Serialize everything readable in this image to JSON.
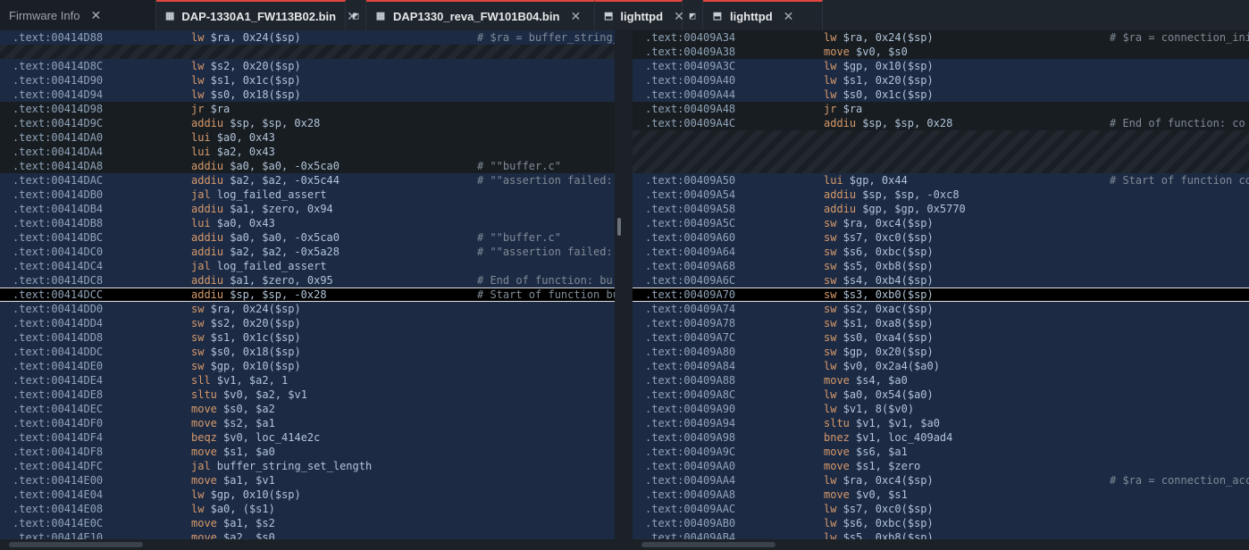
{
  "tabs": [
    {
      "label": "Firmware Info",
      "icon": "info-icon",
      "active": false,
      "width": 175
    },
    {
      "label": "DAP-1330A1_FW113B02.bin",
      "icon": "binary-file-icon",
      "active": true,
      "width": 212,
      "split": true
    },
    {
      "label": "DAP1330_reva_FW101B04.bin",
      "icon": "binary-file-icon",
      "active": true,
      "width": 256
    },
    {
      "label": "lighttpd",
      "icon": "executable-file-icon",
      "active": true,
      "width": 98,
      "split": true
    },
    {
      "label": "lighttpd",
      "icon": "executable-file-icon",
      "active": true,
      "width": 134
    }
  ],
  "left_pane": {
    "lines": [
      {
        "a": ".text:00414D88",
        "m": "lw",
        "o": "$ra, 0x24($sp)",
        "c": "# $ra = buffer_string_",
        "s": "sel"
      },
      {
        "gap": 1
      },
      {
        "a": ".text:00414D8C",
        "m": "lw",
        "o": "$s2, 0x20($sp)",
        "s": "sel"
      },
      {
        "a": ".text:00414D90",
        "m": "lw",
        "o": "$s1, 0x1c($sp)",
        "s": "sel"
      },
      {
        "a": ".text:00414D94",
        "m": "lw",
        "o": "$s0, 0x18($sp)",
        "s": "sel"
      },
      {
        "a": ".text:00414D98",
        "m": "jr",
        "o": "$ra",
        "s": "dark"
      },
      {
        "a": ".text:00414D9C",
        "m": "addiu",
        "o": "$sp, $sp, 0x28",
        "s": "dark"
      },
      {
        "a": ".text:00414DA0",
        "m": "lui",
        "o": "$a0, 0x43",
        "s": "dark"
      },
      {
        "a": ".text:00414DA4",
        "m": "lui",
        "o": "$a2, 0x43",
        "s": "dark"
      },
      {
        "a": ".text:00414DA8",
        "m": "addiu",
        "o": "$a0, $a0, -0x5ca0",
        "c": "# \"\"buffer.c\"",
        "s": "dark"
      },
      {
        "a": ".text:00414DAC",
        "m": "addiu",
        "o": "$a2, $a2, -0x5c44",
        "c": "# \"\"assertion failed:",
        "s": "sel"
      },
      {
        "a": ".text:00414DB0",
        "m": "jal",
        "o": "log_failed_assert",
        "s": "sel"
      },
      {
        "a": ".text:00414DB4",
        "m": "addiu",
        "o": "$a1, $zero, 0x94",
        "s": "sel"
      },
      {
        "a": ".text:00414DB8",
        "m": "lui",
        "o": "$a0, 0x43",
        "s": "sel"
      },
      {
        "a": ".text:00414DBC",
        "m": "addiu",
        "o": "$a0, $a0, -0x5ca0",
        "c": "# \"\"buffer.c\"",
        "s": "sel"
      },
      {
        "a": ".text:00414DC0",
        "m": "addiu",
        "o": "$a2, $a2, -0x5a28",
        "c": "# \"\"assertion failed:",
        "s": "sel"
      },
      {
        "a": ".text:00414DC4",
        "m": "jal",
        "o": "log_failed_assert",
        "s": "sel"
      },
      {
        "a": ".text:00414DC8",
        "m": "addiu",
        "o": "$a1, $zero, 0x95",
        "c": "# End of function: bu",
        "s": "sel"
      },
      {
        "a": ".text:00414DCC",
        "m": "addiu",
        "o": "$sp, $sp, -0x28",
        "c": "# Start of function bu",
        "s": "cur"
      },
      {
        "a": ".text:00414DD0",
        "m": "sw",
        "o": "$ra, 0x24($sp)",
        "s": "sel"
      },
      {
        "a": ".text:00414DD4",
        "m": "sw",
        "o": "$s2, 0x20($sp)",
        "s": "sel"
      },
      {
        "a": ".text:00414DD8",
        "m": "sw",
        "o": "$s1, 0x1c($sp)",
        "s": "sel"
      },
      {
        "a": ".text:00414DDC",
        "m": "sw",
        "o": "$s0, 0x18($sp)",
        "s": "sel"
      },
      {
        "a": ".text:00414DE0",
        "m": "sw",
        "o": "$gp, 0x10($sp)",
        "s": "sel"
      },
      {
        "a": ".text:00414DE4",
        "m": "sll",
        "o": "$v1, $a2, 1",
        "s": "sel"
      },
      {
        "a": ".text:00414DE8",
        "m": "sltu",
        "o": "$v0, $a2, $v1",
        "s": "sel"
      },
      {
        "a": ".text:00414DEC",
        "m": "move",
        "o": "$s0, $a2",
        "s": "sel"
      },
      {
        "a": ".text:00414DF0",
        "m": "move",
        "o": "$s2, $a1",
        "s": "sel"
      },
      {
        "a": ".text:00414DF4",
        "m": "beqz",
        "o": "$v0, loc_414e2c",
        "s": "sel"
      },
      {
        "a": ".text:00414DF8",
        "m": "move",
        "o": "$s1, $a0",
        "s": "sel"
      },
      {
        "a": ".text:00414DFC",
        "m": "jal",
        "o": "buffer_string_set_length",
        "s": "sel"
      },
      {
        "a": ".text:00414E00",
        "m": "move",
        "o": "$a1, $v1",
        "s": "sel"
      },
      {
        "a": ".text:00414E04",
        "m": "lw",
        "o": "$gp, 0x10($sp)",
        "s": "sel"
      },
      {
        "a": ".text:00414E08",
        "m": "lw",
        "o": "$a0, ($s1)",
        "s": "sel"
      },
      {
        "a": ".text:00414E0C",
        "m": "move",
        "o": "$a1, $s2",
        "s": "sel"
      },
      {
        "a": ".text:00414E10",
        "m": "move",
        "o": "$a2, $s0",
        "s": "sel"
      }
    ]
  },
  "right_pane": {
    "lines": [
      {
        "a": ".text:00409A34",
        "m": "lw",
        "o": "$ra, 0x24($sp)",
        "c": "# $ra = connection_ini",
        "s": "dark"
      },
      {
        "a": ".text:00409A38",
        "m": "move",
        "o": "$v0, $s0",
        "s": "dark"
      },
      {
        "a": ".text:00409A3C",
        "m": "lw",
        "o": "$gp, 0x10($sp)",
        "s": "sel"
      },
      {
        "a": ".text:00409A40",
        "m": "lw",
        "o": "$s1, 0x20($sp)",
        "s": "sel"
      },
      {
        "a": ".text:00409A44",
        "m": "lw",
        "o": "$s0, 0x1c($sp)",
        "s": "sel"
      },
      {
        "a": ".text:00409A48",
        "m": "jr",
        "o": "$ra",
        "s": "dark"
      },
      {
        "a": ".text:00409A4C",
        "m": "addiu",
        "o": "$sp, $sp, 0x28",
        "c": "# End of function: co",
        "s": "dark"
      },
      {
        "gap": 3
      },
      {
        "a": ".text:00409A50",
        "m": "lui",
        "o": "$gp, 0x44",
        "c": "# Start of function co",
        "s": "sel"
      },
      {
        "a": ".text:00409A54",
        "m": "addiu",
        "o": "$sp, $sp, -0xc8",
        "s": "sel"
      },
      {
        "a": ".text:00409A58",
        "m": "addiu",
        "o": "$gp, $gp, 0x5770",
        "s": "sel"
      },
      {
        "a": ".text:00409A5C",
        "m": "sw",
        "o": "$ra, 0xc4($sp)",
        "s": "sel"
      },
      {
        "a": ".text:00409A60",
        "m": "sw",
        "o": "$s7, 0xc0($sp)",
        "s": "sel"
      },
      {
        "a": ".text:00409A64",
        "m": "sw",
        "o": "$s6, 0xbc($sp)",
        "s": "sel"
      },
      {
        "a": ".text:00409A68",
        "m": "sw",
        "o": "$s5, 0xb8($sp)",
        "s": "sel"
      },
      {
        "a": ".text:00409A6C",
        "m": "sw",
        "o": "$s4, 0xb4($sp)",
        "s": "sel"
      },
      {
        "a": ".text:00409A70",
        "m": "sw",
        "o": "$s3, 0xb0($sp)",
        "s": "cur"
      },
      {
        "a": ".text:00409A74",
        "m": "sw",
        "o": "$s2, 0xac($sp)",
        "s": "sel"
      },
      {
        "a": ".text:00409A78",
        "m": "sw",
        "o": "$s1, 0xa8($sp)",
        "s": "sel"
      },
      {
        "a": ".text:00409A7C",
        "m": "sw",
        "o": "$s0, 0xa4($sp)",
        "s": "sel"
      },
      {
        "a": ".text:00409A80",
        "m": "sw",
        "o": "$gp, 0x20($sp)",
        "s": "sel"
      },
      {
        "a": ".text:00409A84",
        "m": "lw",
        "o": "$v0, 0x2a4($a0)",
        "s": "sel"
      },
      {
        "a": ".text:00409A88",
        "m": "move",
        "o": "$s4, $a0",
        "s": "sel"
      },
      {
        "a": ".text:00409A8C",
        "m": "lw",
        "o": "$a0, 0x54($a0)",
        "s": "sel"
      },
      {
        "a": ".text:00409A90",
        "m": "lw",
        "o": "$v1, 8($v0)",
        "s": "sel"
      },
      {
        "a": ".text:00409A94",
        "m": "sltu",
        "o": "$v1, $v1, $a0",
        "s": "sel"
      },
      {
        "a": ".text:00409A98",
        "m": "bnez",
        "o": "$v1, loc_409ad4",
        "s": "sel"
      },
      {
        "a": ".text:00409A9C",
        "m": "move",
        "o": "$s6, $a1",
        "s": "sel"
      },
      {
        "a": ".text:00409AA0",
        "m": "move",
        "o": "$s1, $zero",
        "s": "sel"
      },
      {
        "a": ".text:00409AA4",
        "m": "lw",
        "o": "$ra, 0xc4($sp)",
        "c": "# $ra = connection_acc",
        "s": "sel"
      },
      {
        "a": ".text:00409AA8",
        "m": "move",
        "o": "$v0, $s1",
        "s": "sel"
      },
      {
        "a": ".text:00409AAC",
        "m": "lw",
        "o": "$s7, 0xc0($sp)",
        "s": "sel"
      },
      {
        "a": ".text:00409AB0",
        "m": "lw",
        "o": "$s6, 0xbc($sp)",
        "s": "sel"
      },
      {
        "a": ".text:00409AB4",
        "m": "lw",
        "o": "$s5, 0xb8($sp)",
        "s": "sel"
      }
    ]
  },
  "colors": {
    "selected": "#1d2a44",
    "mnemonic": "#d69a6a",
    "address": "#8fa3b8",
    "accent": "#e1463f"
  }
}
